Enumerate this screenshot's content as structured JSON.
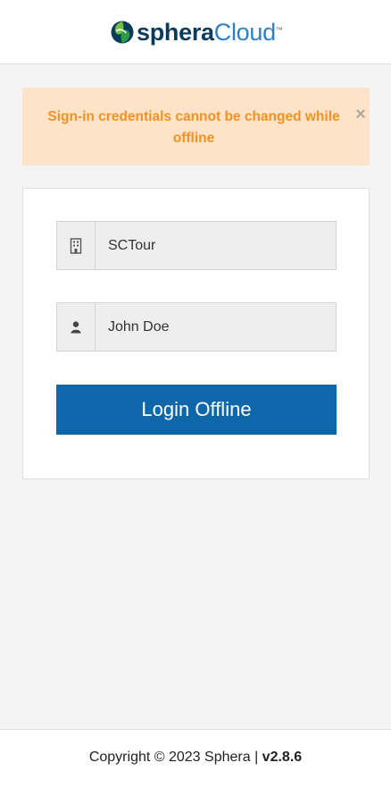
{
  "header": {
    "logo": {
      "part1": "sphera",
      "part2": "Cloud",
      "tm": "™"
    }
  },
  "alert": {
    "message": "Sign-in credentials cannot be changed while offline",
    "close_glyph": "×",
    "color": "#f39222",
    "background": "#fde3c8"
  },
  "login": {
    "tenant": {
      "value": "SCTour",
      "icon": "building-icon"
    },
    "username": {
      "value": "John Doe",
      "icon": "user-icon"
    },
    "button_label": "Login Offline",
    "button_color": "#0d67a9"
  },
  "footer": {
    "copyright": "Copyright © 2023 Sphera | ",
    "version": "v2.8.6"
  }
}
